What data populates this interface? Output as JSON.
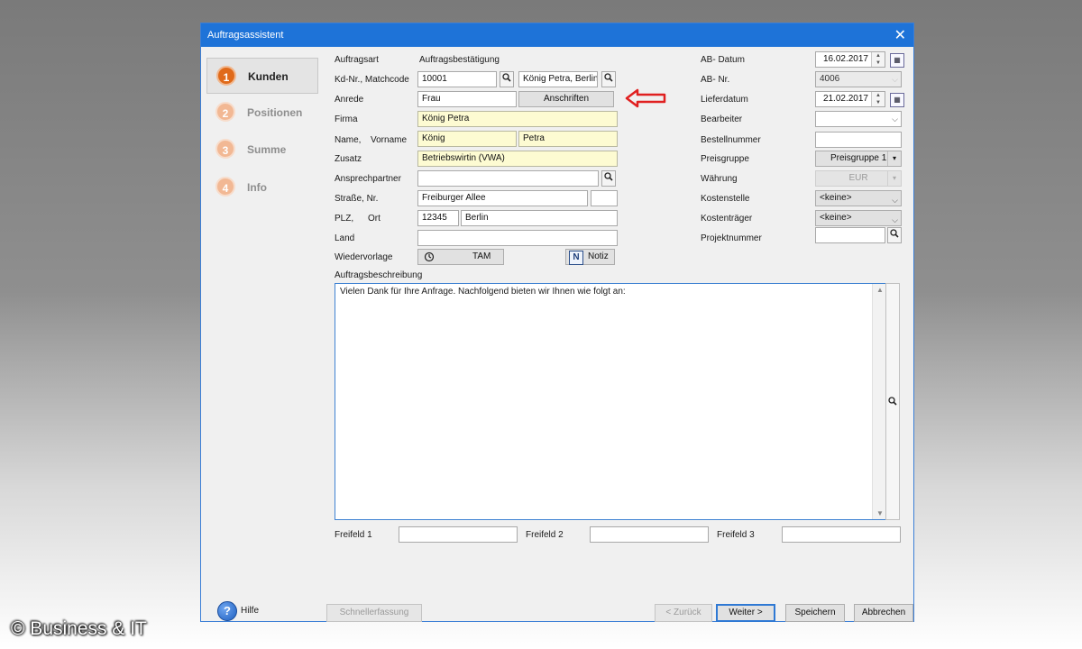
{
  "window": {
    "title": "Auftragsassistent",
    "close_glyph": "✕"
  },
  "steps": [
    {
      "num": "1",
      "label": "Kunden"
    },
    {
      "num": "2",
      "label": "Positionen"
    },
    {
      "num": "3",
      "label": "Summe"
    },
    {
      "num": "4",
      "label": "Info"
    }
  ],
  "left_form": {
    "auftragsart_label": "Auftragsart",
    "auftragsart_value": "Auftragsbestätigung",
    "kdnr_label": "Kd-Nr., Matchcode",
    "kdnr_value": "10001",
    "matchcode_value": "König Petra, Berlin",
    "anrede_label": "Anrede",
    "anrede_value": "Frau",
    "anschriften_button": "Anschriften",
    "firma_label": "Firma",
    "firma_value": "König Petra",
    "name_label": "Name,",
    "vorname_label": "Vorname",
    "name_value": "König",
    "vorname_value": "Petra",
    "zusatz_label": "Zusatz",
    "zusatz_value": "Betriebswirtin (VWA)",
    "ansprechpartner_label": "Ansprechpartner",
    "ansprechpartner_value": "",
    "strasse_label": "Straße, Nr.",
    "strasse_value": "Freiburger Allee",
    "nr_value": "",
    "plz_label": "PLZ,",
    "ort_label": "Ort",
    "plz_value": "12345",
    "ort_value": "Berlin",
    "land_label": "Land",
    "land_value": "",
    "wiedervorlage_label": "Wiedervorlage",
    "tam_button": "TAM",
    "notiz_button": "Notiz",
    "notiz_icon_glyph": "N"
  },
  "right_form": {
    "ab_datum_label": "AB- Datum",
    "ab_datum_value": "16.02.2017",
    "ab_nr_label": "AB- Nr.",
    "ab_nr_value": "4006",
    "lieferdatum_label": "Lieferdatum",
    "lieferdatum_value": "21.02.2017",
    "bearbeiter_label": "Bearbeiter",
    "bearbeiter_value": "",
    "bestellnummer_label": "Bestellnummer",
    "bestellnummer_value": "",
    "preisgruppe_label": "Preisgruppe",
    "preisgruppe_value": "Preisgruppe 1",
    "waehrung_label": "Währung",
    "waehrung_value": "EUR",
    "kostenstelle_label": "Kostenstelle",
    "kostenstelle_value": "<keine>",
    "kostentraeger_label": "Kostenträger",
    "kostentraeger_value": "<keine>",
    "projektnummer_label": "Projektnummer",
    "projektnummer_value": ""
  },
  "description": {
    "label": "Auftragsbeschreibung",
    "text": "Vielen Dank für Ihre Anfrage. Nachfolgend bieten wir Ihnen wie folgt an:"
  },
  "freifelder": {
    "f1_label": "Freifeld 1",
    "f2_label": "Freifeld 2",
    "f3_label": "Freifeld 3"
  },
  "footer": {
    "help_label": "Hilfe",
    "help_glyph": "?",
    "schnellerfassung": "Schnellerfassung",
    "zurueck": "< Zurück",
    "weiter": "Weiter >",
    "speichern": "Speichern",
    "abbrechen": "Abbrechen"
  },
  "watermark": "© Business & IT",
  "colors": {
    "titlebar": "#1e73d8",
    "active_step": "#e06a1a",
    "inactive_step": "#f2b894",
    "required_field": "#fdfbd2",
    "annotation_arrow": "#e02020"
  },
  "icons": {
    "search": "magnifier-icon",
    "calendar": "calendar-icon",
    "clock": "clock-icon",
    "arrow": "red-left-arrow-icon"
  }
}
